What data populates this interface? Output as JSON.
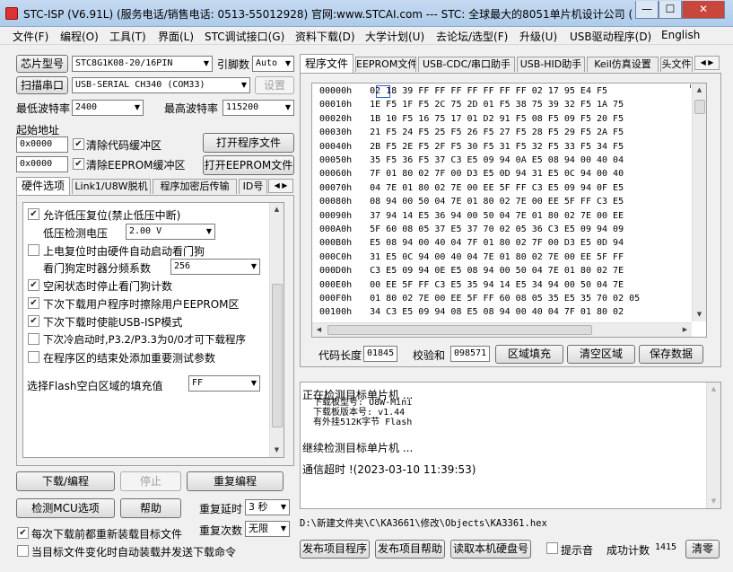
{
  "window": {
    "title": "STC-ISP (V6.91L) (服务电话/销售电话: 0513-55012928) 官网:www.STCAI.com  --- STC: 全球最大的8051单片机设计公司 (...",
    "minimize": "—",
    "maximize": "☐",
    "close": "✕"
  },
  "menu": [
    "文件(F)",
    "编程(O)",
    "工具(T)",
    "界面(L)",
    "STC调试接口(G)",
    "资料下载(D)",
    "大学计划(U)",
    "去论坛/选型(F)",
    "升级(U)",
    "USB驱动程序(D)",
    "English"
  ],
  "left": {
    "chip_btn": "芯片型号",
    "chip_value": "STC8G1K08-20/16PIN",
    "pins_label": "引脚数",
    "pins_value": "Auto",
    "scan_btn": "扫描串口",
    "port_value": "USB-SERIAL CH340 (COM33)",
    "settings_btn": "设置",
    "min_baud_label": "最低波特率",
    "min_baud": "2400",
    "max_baud_label": "最高波特率",
    "max_baud": "115200",
    "start_addr_label": "起始地址",
    "addr1": "0x0000",
    "clear_code": "清除代码缓冲区",
    "open_prog": "打开程序文件",
    "addr2": "0x0000",
    "clear_eeprom": "清除EEPROM缓冲区",
    "open_eeprom": "打开EEPROM文件",
    "tabs": [
      "硬件选项",
      "Link1/U8W脱机",
      "程序加密后传输",
      "ID号"
    ],
    "options": [
      {
        "label": "允许低压复位(禁止低压中断)",
        "checked": true
      },
      {
        "label": "低压检测电压",
        "value": "2.00 V"
      },
      {
        "label": "上电复位时由硬件自动启动看门狗",
        "checked": false
      },
      {
        "label": "看门狗定时器分频系数",
        "value": "256"
      },
      {
        "label": "空闲状态时停止看门狗计数",
        "checked": true
      },
      {
        "label": "下次下载用户程序时擦除用户EEPROM区",
        "checked": true
      },
      {
        "label": "下次下载时使能USB-ISP模式",
        "checked": true
      },
      {
        "label": "下次冷启动时,P3.2/P3.3为0/0才可下载程序",
        "checked": false
      },
      {
        "label": "在程序区的结束处添加重要测试参数",
        "checked": false
      },
      {
        "label": "选择Flash空白区域的填充值",
        "value": "FF"
      }
    ],
    "download_btn": "下载/编程",
    "stop_btn": "停止",
    "reprog_btn": "重复编程",
    "detect_btn": "检测MCU选项",
    "help_btn": "帮助",
    "delay_label": "重复延时",
    "delay_value": "3 秒",
    "count_label": "重复次数",
    "count_value": "无限",
    "reload_label": "每次下载前都重新装载目标文件",
    "auto_label": "当目标文件变化时自动装载并发送下载命令"
  },
  "right": {
    "tabs": [
      "程序文件",
      "EEPROM文件",
      "USB-CDC/串口助手",
      "USB-HID助手",
      "Keil仿真设置",
      "头文件"
    ],
    "hex_rows": [
      {
        "addr": "00000h",
        "bytes": "02 18 39 FF FF FF FF FF FF FF 02 17 95 E4 F5"
      },
      {
        "addr": "00010h",
        "bytes": "1E F5 1F F5 2C 75 2D 01 F5 38 75 39 32 F5 1A 75"
      },
      {
        "addr": "00020h",
        "bytes": "1B 10 F5 16 75 17 01 D2 91 F5 08 F5 09 F5 20 F5"
      },
      {
        "addr": "00030h",
        "bytes": "21 F5 24 F5 25 F5 26 F5 27 F5 28 F5 29 F5 2A F5"
      },
      {
        "addr": "00040h",
        "bytes": "2B F5 2E F5 2F F5 30 F5 31 F5 32 F5 33 F5 34 F5"
      },
      {
        "addr": "00050h",
        "bytes": "35 F5 36 F5 37 C3 E5 09 94 0A E5 08 94 00 40 04"
      },
      {
        "addr": "00060h",
        "bytes": "7F 01 80 02 7F 00 D3 E5 0D 94 31 E5 0C 94 00 40"
      },
      {
        "addr": "00070h",
        "bytes": "04 7E 01 80 02 7E 00 EE 5F FF C3 E5 09 94 0F E5"
      },
      {
        "addr": "00080h",
        "bytes": "08 94 00 50 04 7E 01 80 02 7E 00 EE 5F FF C3 E5"
      },
      {
        "addr": "00090h",
        "bytes": "37 94 14 E5 36 94 00 50 04 7E 01 80 02 7E 00 EE"
      },
      {
        "addr": "000A0h",
        "bytes": "5F 60 08 05 37 E5 37 70 02 05 36 C3 E5 09 94 09"
      },
      {
        "addr": "000B0h",
        "bytes": "E5 08 94 00 40 04 7F 01 80 02 7F 00 D3 E5 0D 94"
      },
      {
        "addr": "000C0h",
        "bytes": "31 E5 0C 94 00 40 04 7E 01 80 02 7E 00 EE 5F FF"
      },
      {
        "addr": "000D0h",
        "bytes": "C3 E5 09 94 0E E5 08 94 00 50 04 7E 01 80 02 7E"
      },
      {
        "addr": "000E0h",
        "bytes": "00 EE 5F FF C3 E5 35 94 14 E5 34 94 00 50 04 7E"
      },
      {
        "addr": "000F0h",
        "bytes": "01 80 02 7E 00 EE 5F FF 60 08 05 35 E5 35 70 02 05"
      },
      {
        "addr": "00100h",
        "bytes": "34 C3 E5 09 94 08 E5 08 94 00 40 04 7F 01 80 02"
      }
    ],
    "first_byte": "02",
    "code_len_label": "代码长度",
    "code_len": "01845",
    "checksum_label": "校验和",
    "checksum": "098571",
    "fill_btn": "区域填充",
    "clear_btn": "清空区域",
    "save_btn": "保存数据",
    "log": [
      "正在检测目标单片机 ...",
      "  下载板型号: U8W-Mini",
      "  下载板版本号: v1.44",
      "  有外挂512K字节 Flash",
      "",
      "继续检测目标单片机 ...",
      "",
      "通信超时 !(2023-03-10 11:39:53)"
    ],
    "path": "D:\\新建文件夹\\C\\KA3661\\修改\\Objects\\KA3361.hex",
    "publish_btn": "发布项目程序",
    "publish_help_btn": "发布项目帮助",
    "read_disk_btn": "读取本机硬盘号",
    "sound_label": "提示音",
    "success_label": "成功计数",
    "success_value": "1415",
    "clear_count_btn": "清零"
  }
}
